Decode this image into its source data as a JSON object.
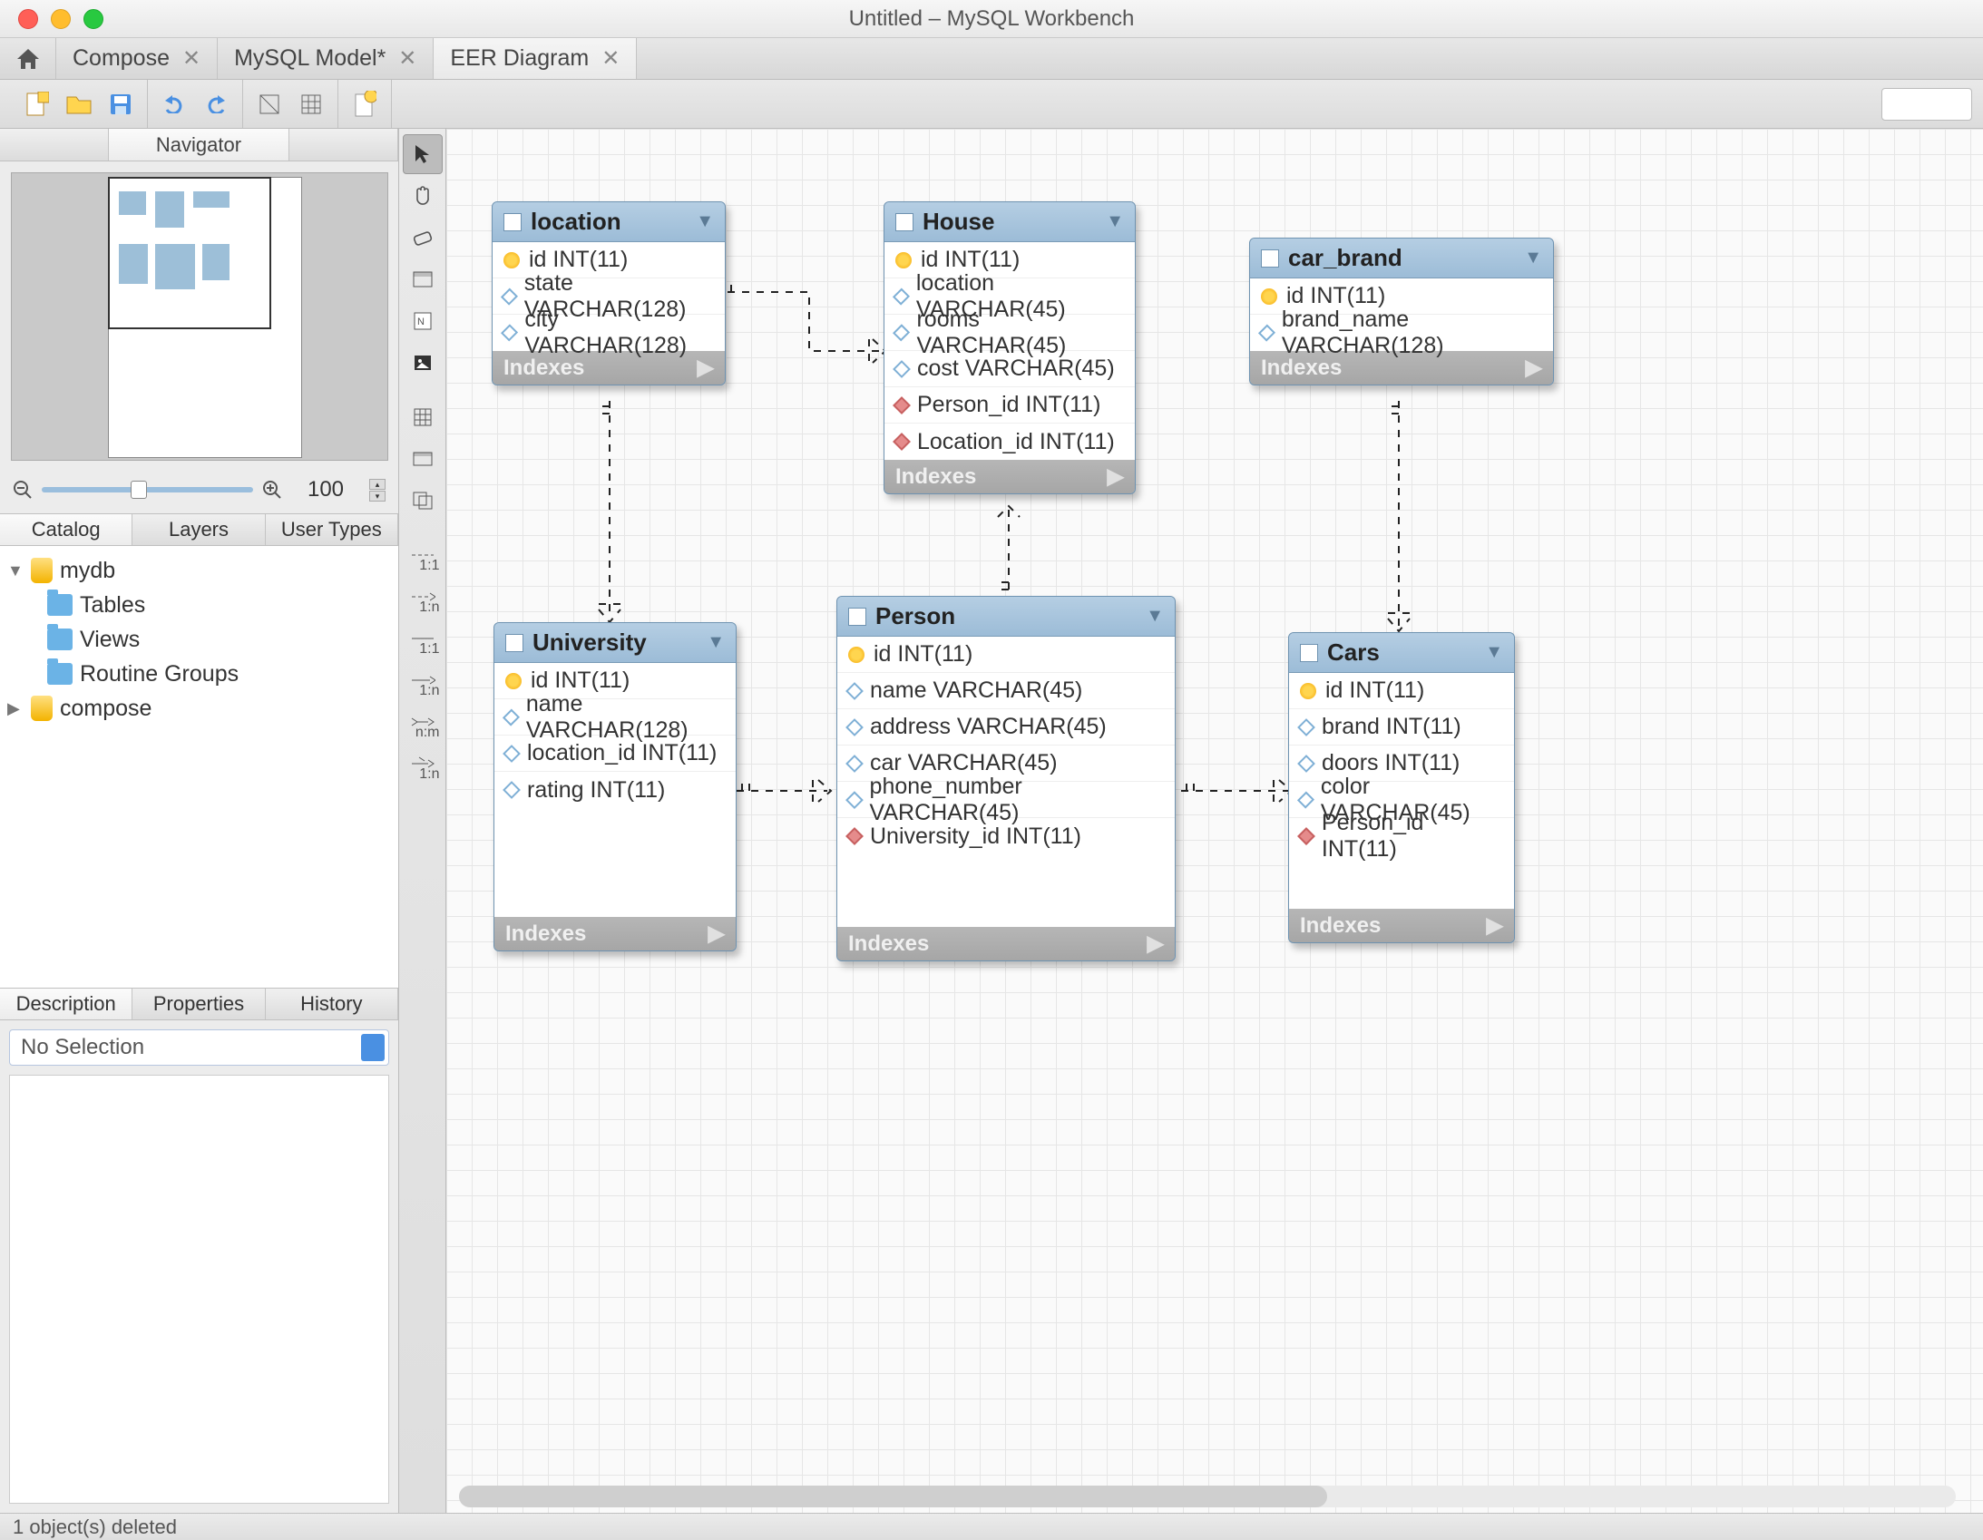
{
  "window": {
    "title": "Untitled – MySQL Workbench"
  },
  "tabs": [
    {
      "label": "Compose",
      "closable": true,
      "active": false
    },
    {
      "label": "MySQL Model*",
      "closable": true,
      "active": false
    },
    {
      "label": "EER Diagram",
      "closable": true,
      "active": true
    }
  ],
  "navigator": {
    "label": "Navigator"
  },
  "zoom": {
    "value": "100"
  },
  "catalog_tabs": {
    "catalog": "Catalog",
    "layers": "Layers",
    "user_types": "User Types"
  },
  "tree": {
    "db1": "mydb",
    "db1_children": {
      "tables": "Tables",
      "views": "Views",
      "routine_groups": "Routine Groups"
    },
    "db2": "compose"
  },
  "bottom_tabs": {
    "description": "Description",
    "properties": "Properties",
    "history": "History"
  },
  "selection": {
    "text": "No Selection"
  },
  "palette_labels": {
    "rel11": "1:1",
    "rel1n": "1:n",
    "rel11b": "1:1",
    "rel1nb": "1:n",
    "relnm": "n:m",
    "rel1nc": "1:n"
  },
  "entities": {
    "location": {
      "title": "location",
      "cols": [
        {
          "kind": "pk",
          "text": "id INT(11)"
        },
        {
          "kind": "col",
          "text": "state VARCHAR(128)"
        },
        {
          "kind": "col",
          "text": "city VARCHAR(128)"
        }
      ],
      "footer": "Indexes"
    },
    "house": {
      "title": "House",
      "cols": [
        {
          "kind": "pk",
          "text": "id INT(11)"
        },
        {
          "kind": "col",
          "text": "location VARCHAR(45)"
        },
        {
          "kind": "col",
          "text": "rooms VARCHAR(45)"
        },
        {
          "kind": "col",
          "text": "cost VARCHAR(45)"
        },
        {
          "kind": "fk",
          "text": "Person_id INT(11)"
        },
        {
          "kind": "fk",
          "text": "Location_id INT(11)"
        }
      ],
      "footer": "Indexes"
    },
    "car_brand": {
      "title": "car_brand",
      "cols": [
        {
          "kind": "pk",
          "text": "id INT(11)"
        },
        {
          "kind": "col",
          "text": "brand_name VARCHAR(128)"
        }
      ],
      "footer": "Indexes"
    },
    "university": {
      "title": "University",
      "cols": [
        {
          "kind": "pk",
          "text": "id INT(11)"
        },
        {
          "kind": "col",
          "text": "name VARCHAR(128)"
        },
        {
          "kind": "col",
          "text": "location_id INT(11)"
        },
        {
          "kind": "col",
          "text": "rating INT(11)"
        }
      ],
      "footer": "Indexes"
    },
    "person": {
      "title": "Person",
      "cols": [
        {
          "kind": "pk",
          "text": "id INT(11)"
        },
        {
          "kind": "col",
          "text": "name VARCHAR(45)"
        },
        {
          "kind": "col",
          "text": "address VARCHAR(45)"
        },
        {
          "kind": "col",
          "text": "car VARCHAR(45)"
        },
        {
          "kind": "col",
          "text": "phone_number VARCHAR(45)"
        },
        {
          "kind": "fk",
          "text": "University_id INT(11)"
        }
      ],
      "footer": "Indexes"
    },
    "cars": {
      "title": "Cars",
      "cols": [
        {
          "kind": "pk",
          "text": "id INT(11)"
        },
        {
          "kind": "col",
          "text": "brand INT(11)"
        },
        {
          "kind": "col",
          "text": "doors INT(11)"
        },
        {
          "kind": "col",
          "text": "color VARCHAR(45)"
        },
        {
          "kind": "fk",
          "text": "Person_id INT(11)"
        }
      ],
      "footer": "Indexes"
    }
  },
  "status": {
    "text": "1 object(s) deleted"
  }
}
